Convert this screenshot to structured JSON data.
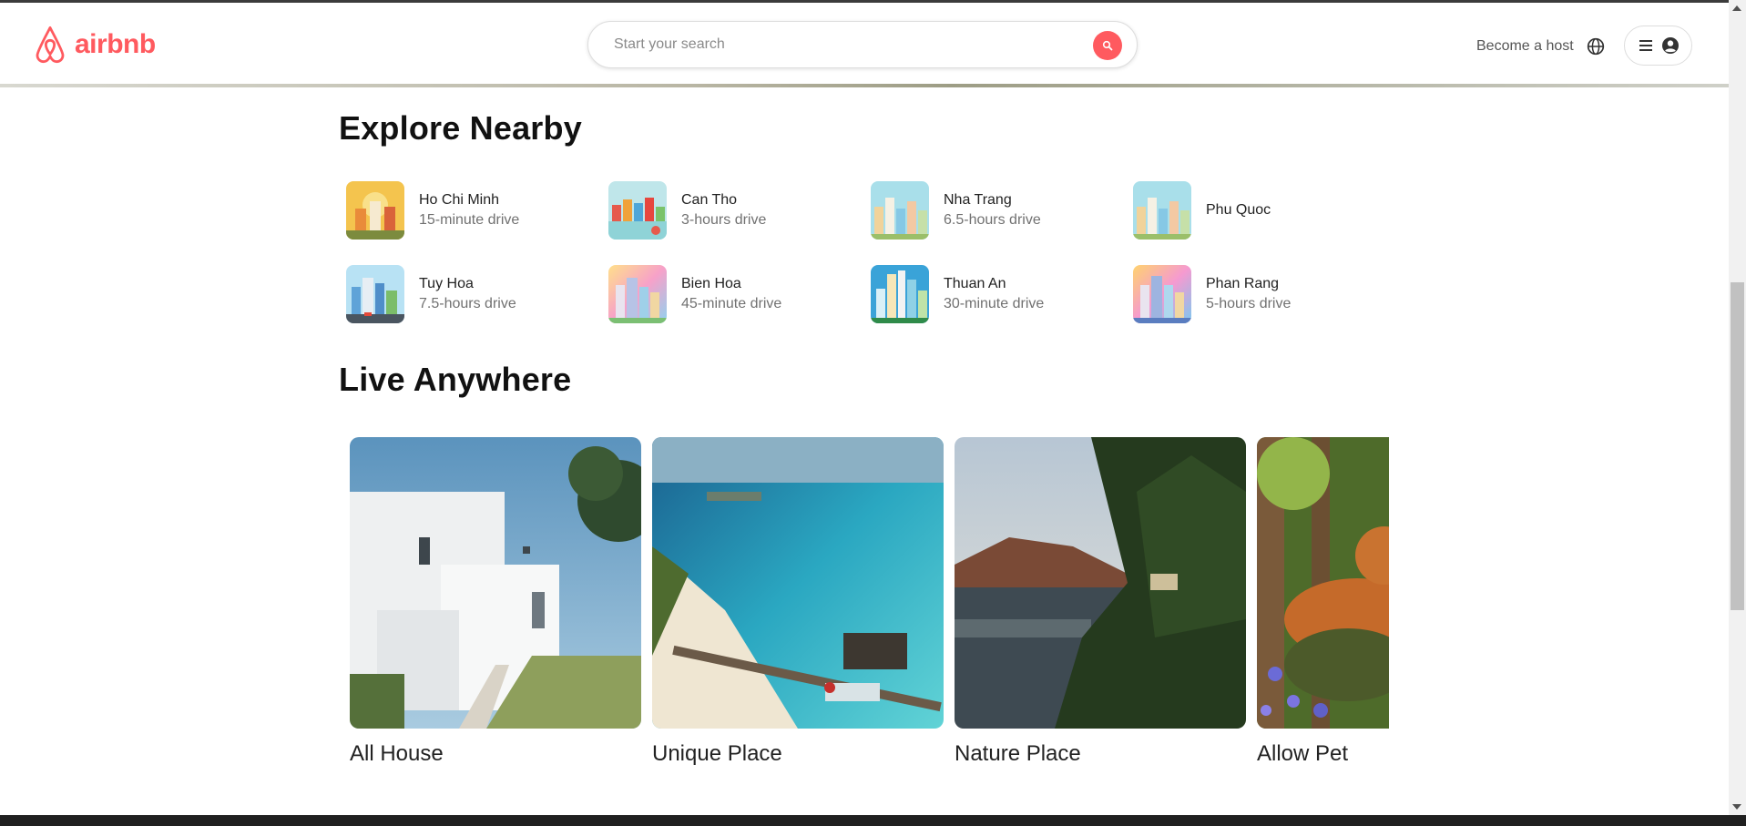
{
  "brand": {
    "name": "airbnb",
    "color": "#ff5a5f"
  },
  "search": {
    "placeholder": "Start your search",
    "icon": "search-icon"
  },
  "header": {
    "host_link": "Become a host",
    "globe_icon": "globe-icon",
    "menu_icon": "hamburger-icon",
    "user_icon": "user-circle-icon"
  },
  "explore": {
    "title": "Explore Nearby",
    "items": [
      {
        "name": "Ho Chi Minh",
        "distance": "15-minute drive"
      },
      {
        "name": "Can Tho",
        "distance": "3-hours drive"
      },
      {
        "name": "Nha Trang",
        "distance": "6.5-hours drive"
      },
      {
        "name": "Phu Quoc",
        "distance": ""
      },
      {
        "name": "Tuy Hoa",
        "distance": "7.5-hours drive"
      },
      {
        "name": "Bien Hoa",
        "distance": "45-minute drive"
      },
      {
        "name": "Thuan An",
        "distance": "30-minute drive"
      },
      {
        "name": "Phan Rang",
        "distance": "5-hours drive"
      }
    ]
  },
  "live": {
    "title": "Live Anywhere",
    "cards": [
      {
        "label": "All House"
      },
      {
        "label": "Unique Place"
      },
      {
        "label": "Nature Place"
      },
      {
        "label": "Allow Pet"
      }
    ]
  }
}
